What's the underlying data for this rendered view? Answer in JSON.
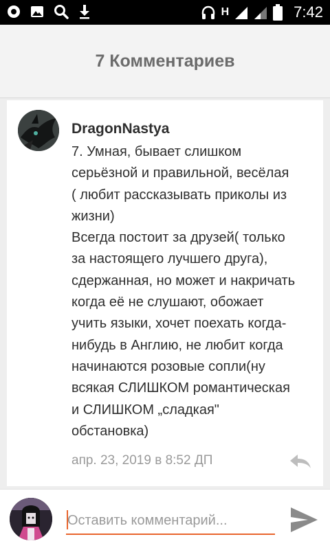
{
  "status_bar": {
    "time": "7:42",
    "network_type": "H",
    "left_icons": [
      "record-icon",
      "image-icon",
      "search-icon",
      "download-icon"
    ],
    "right_icons": [
      "headphones-icon",
      "signal-icon",
      "signal-icon",
      "battery-icon"
    ]
  },
  "header": {
    "title": "7 Комментариев"
  },
  "comment": {
    "author": "DragonNastya",
    "text_lines": [
      "7. Умная, бывает слишком",
      "серьёзной и правильной, весёлая",
      "( любит рассказывать приколы из",
      "жизни)",
      "Всегда постоит за друзей( только",
      "за настоящего лучшего друга),",
      "сдержанная, но может и накричать",
      "когда её не слушают, обожает",
      "учить языки, хочет поехать когда-",
      "нибудь в  Англию, не любит когда",
      "начинаются розовые сопли(ну",
      "всякая СЛИШКОМ романтическая",
      "и СЛИШКОМ „сладкая\"",
      "обстановка)"
    ],
    "timestamp": "апр. 23, 2019 в 8:52 ДП"
  },
  "composer": {
    "placeholder": "Оставить комментарий...",
    "accent_color": "#e8642c"
  },
  "colors": {
    "header_bg": "#f3f3f3",
    "page_bg": "#eeeeee",
    "title": "#6b6b6b",
    "text": "#2e2e2e",
    "muted": "#9a9a9a"
  }
}
